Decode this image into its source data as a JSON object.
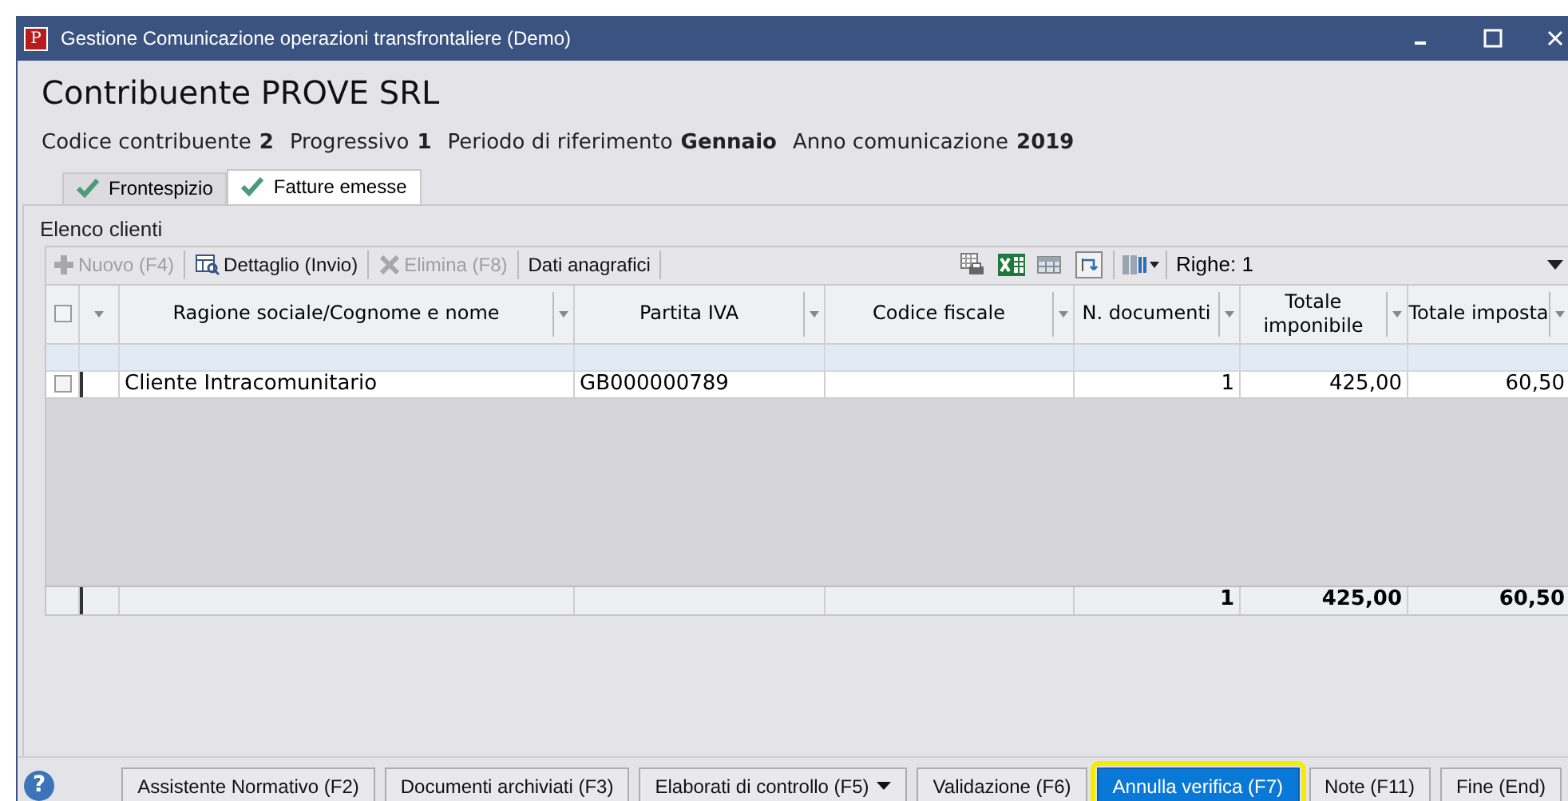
{
  "window": {
    "title": "Gestione Comunicazione operazioni transfrontaliere  (Demo)",
    "app_icon_letter": "P"
  },
  "heading": "Contribuente PROVE SRL",
  "info": [
    {
      "label": "Codice contribuente",
      "value": "2"
    },
    {
      "label": "Progressivo",
      "value": "1"
    },
    {
      "label": "Periodo di riferimento",
      "value": "Gennaio"
    },
    {
      "label": "Anno comunicazione",
      "value": "2019"
    }
  ],
  "tabs": [
    {
      "label": "Frontespizio",
      "selected": false,
      "complete": true
    },
    {
      "label": "Fatture emesse",
      "selected": true,
      "complete": true
    }
  ],
  "section_title": "Elenco clienti",
  "toolbar": [
    {
      "kind": "new",
      "label": "Nuovo (F4)",
      "disabled": true
    },
    {
      "kind": "detail",
      "label": "Dettaglio (Invio)",
      "disabled": false
    },
    {
      "kind": "delete",
      "label": "Elimina (F8)",
      "disabled": true
    },
    {
      "kind": "text",
      "label": "Dati anagrafici",
      "disabled": false
    }
  ],
  "rows_counter": "Righe: 1",
  "table": {
    "columns": [
      "Ragione sociale/Cognome e nome",
      "Partita IVA",
      "Codice fiscale",
      "N. documenti",
      "Totale imponibile",
      "Totale imposta"
    ],
    "header_checked": false,
    "rows": [
      {
        "checked": false,
        "cells": [
          "Cliente Intracomunitario",
          "GB000000789",
          null,
          "1",
          "425,00",
          "60,50"
        ]
      }
    ],
    "totals": {
      "n_documenti": "1",
      "totale_imponibile": "425,00",
      "totale_imposta": "60,50"
    }
  },
  "help_glyph": "?",
  "buttons": [
    {
      "label": "Assistente Normativo (F2)",
      "focused": false,
      "has_menu": false,
      "highlighted": false
    },
    {
      "label": "Documenti archiviati (F3)",
      "focused": false,
      "has_menu": false,
      "highlighted": false
    },
    {
      "label": "Elaborati di controllo (F5)",
      "focused": false,
      "has_menu": true,
      "highlighted": false
    },
    {
      "label": "Validazione (F6)",
      "focused": false,
      "has_menu": false,
      "highlighted": false
    },
    {
      "label": "Annulla verifica (F7)",
      "focused": true,
      "has_menu": false,
      "highlighted": true
    },
    {
      "label": "Note (F11)",
      "focused": false,
      "has_menu": false,
      "highlighted": false
    },
    {
      "label": "Fine (End)",
      "focused": false,
      "has_menu": false,
      "highlighted": false
    }
  ]
}
